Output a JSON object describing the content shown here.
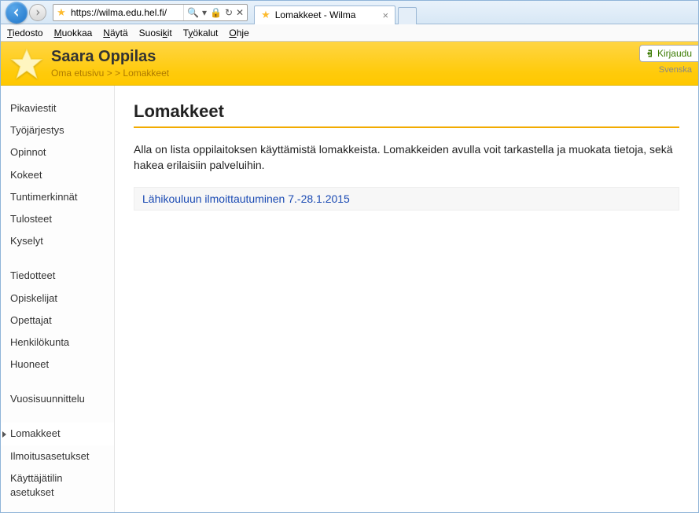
{
  "browser": {
    "url": "https://wilma.edu.hel.fi/",
    "tab_title": "Lomakkeet - Wilma"
  },
  "menubar": {
    "tiedosto": "Tiedosto",
    "muokkaa": "Muokkaa",
    "nayta": "Näytä",
    "suosikit": "Suosikit",
    "tyokalut": "Työkalut",
    "ohje": "Ohje"
  },
  "header": {
    "user": "Saara Oppilas",
    "crumb_home": "Oma etusivu",
    "crumb_sep": " > > ",
    "crumb_current": "Lomakkeet",
    "logout_label": "Kirjaudu",
    "lang": "Svenska"
  },
  "sidebar": {
    "g1": [
      {
        "label": "Pikaviestit"
      },
      {
        "label": "Työjärjestys"
      },
      {
        "label": "Opinnot"
      },
      {
        "label": "Kokeet"
      },
      {
        "label": "Tuntimerkinnät"
      },
      {
        "label": "Tulosteet"
      },
      {
        "label": "Kyselyt"
      }
    ],
    "g2": [
      {
        "label": "Tiedotteet"
      },
      {
        "label": "Opiskelijat"
      },
      {
        "label": "Opettajat"
      },
      {
        "label": "Henkilökunta"
      },
      {
        "label": "Huoneet"
      }
    ],
    "g3": [
      {
        "label": "Vuosisuunnittelu"
      }
    ],
    "g4": [
      {
        "label": "Lomakkeet",
        "active": true
      },
      {
        "label": "Ilmoitusasetukset"
      },
      {
        "label": "Käyttäjätilin asetukset"
      }
    ]
  },
  "main": {
    "title": "Lomakkeet",
    "intro": "Alla on lista oppilaitoksen käyttämistä lomakkeista. Lomakkeiden avulla voit tarkastella ja muokata tietoja, sekä hakea erilaisiin palveluihin.",
    "forms": [
      {
        "name": "Lähikouluun ilmoittautuminen 7.-28.1.2015"
      }
    ]
  }
}
